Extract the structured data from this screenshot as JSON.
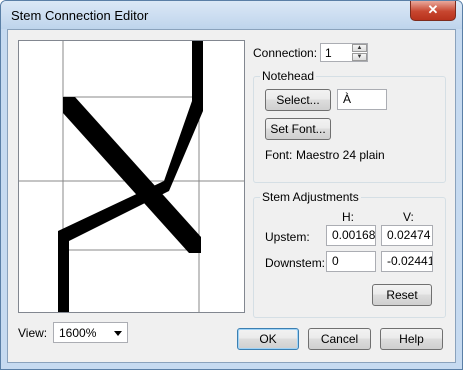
{
  "window": {
    "title": "Stem Connection Editor",
    "close_glyph": "✕"
  },
  "connection": {
    "label": "Connection:",
    "value": "1"
  },
  "notehead": {
    "group_label": "Notehead",
    "select_label": "Select...",
    "glyph_value": "À",
    "set_font_label": "Set Font...",
    "font_label": "Font:",
    "font_value": "Maestro 24 plain"
  },
  "stem_adjustments": {
    "group_label": "Stem Adjustments",
    "col_h": "H:",
    "col_v": "V:",
    "upstem": {
      "label": "Upstem:",
      "h": "0.00168",
      "v": "0.02474"
    },
    "downstem": {
      "label": "Downstem:",
      "h": "0",
      "v": "-0.02441"
    },
    "reset_label": "Reset"
  },
  "view": {
    "label": "View:",
    "value": "1600%"
  },
  "buttons": {
    "ok": "OK",
    "cancel": "Cancel",
    "help": "Help"
  }
}
